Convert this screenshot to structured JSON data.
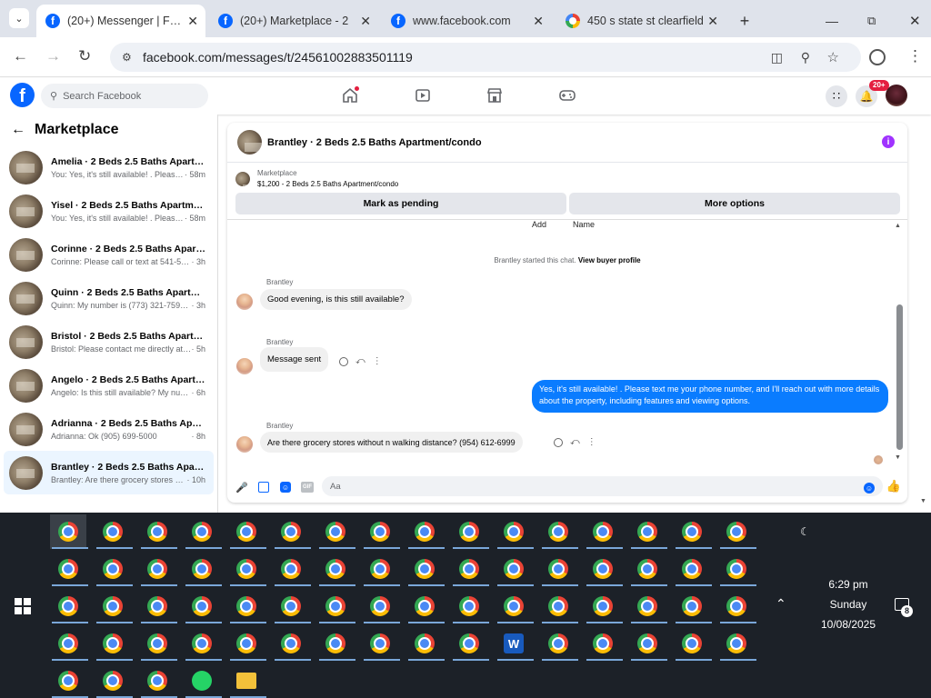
{
  "browser": {
    "tabs": [
      {
        "title": "(20+) Messenger | Face",
        "icon": "facebook-icon",
        "active": true
      },
      {
        "title": "(20+) Marketplace - 2",
        "icon": "facebook-icon",
        "active": false
      },
      {
        "title": "www.facebook.com",
        "icon": "facebook-icon",
        "active": false
      },
      {
        "title": "450 s state st clearfield",
        "icon": "google-icon",
        "active": false
      }
    ],
    "url": "facebook.com/messages/t/24561002883501119"
  },
  "facebook": {
    "search_placeholder": "Search Facebook",
    "notification_badge": "20+"
  },
  "sidebar": {
    "title": "Marketplace",
    "conversations": [
      {
        "name": "Amelia · 2 Beds 2.5 Baths Apartme...",
        "preview": "You: Yes, it's still available! . Please t...",
        "time": "· 58m"
      },
      {
        "name": "Yisel · 2 Beds 2.5 Baths Apartment...",
        "preview": "You: Yes, it's still available! . Please t...",
        "time": "· 58m"
      },
      {
        "name": "Corinne · 2 Beds 2.5 Baths Apartm...",
        "preview": "Corinne: Please call or text at 541-546...",
        "time": "· 3h"
      },
      {
        "name": "Quinn · 2 Beds 2.5 Baths Apartme...",
        "preview": "Quinn: My number is (773) 321-7599 ...",
        "time": "· 3h"
      },
      {
        "name": "Bristol · 2 Beds 2.5 Baths Apartme...",
        "preview": "Bristol: Please contact me directly at 6...",
        "time": "· 5h"
      },
      {
        "name": "Angelo · 2 Beds 2.5 Baths Apartme...",
        "preview": "Angelo: Is this still available? My num...",
        "time": "· 6h"
      },
      {
        "name": "Adrianna · 2 Beds 2.5 Baths Apart...",
        "preview": "Adrianna: Ok (905) 699-5000",
        "time": "· 8h"
      },
      {
        "name": "Brantley · 2 Beds 2.5 Baths Apartm...",
        "preview": "Brantley: Are there grocery stores wit...",
        "time": "· 10h"
      }
    ]
  },
  "chat": {
    "title": "Brantley · 2 Beds 2.5 Baths Apartment/condo",
    "marketplace_label": "Marketplace",
    "listing": "$1,200 - 2 Beds 2.5 Baths Apartment/condo",
    "mark_pending": "Mark as pending",
    "more_options": "More options",
    "add_label": "Add",
    "name_label": "Name",
    "system_text": "Brantley started this chat.",
    "view_buyer": "View buyer profile",
    "messages": [
      {
        "sender": "Brantley",
        "text": "Good evening, is this still available?"
      },
      {
        "sender": "Brantley",
        "text": "Message sent"
      },
      {
        "sender": "You",
        "text": "Yes, it's still available! . Please text me your phone number, and I'll reach out with more details about the property, including features and viewing options."
      },
      {
        "sender": "Brantley",
        "text": "Are there grocery stores without n walking distance? (954) 612-6999"
      }
    ],
    "composer_placeholder": "Aa"
  },
  "taskbar": {
    "time": "6:29 pm",
    "day": "Sunday",
    "date": "10/08/2025",
    "notification_count": "8"
  },
  "colors": {
    "facebook_blue": "#0866ff",
    "message_blue": "#0a7cff",
    "taskbar_bg": "#1c2128"
  }
}
